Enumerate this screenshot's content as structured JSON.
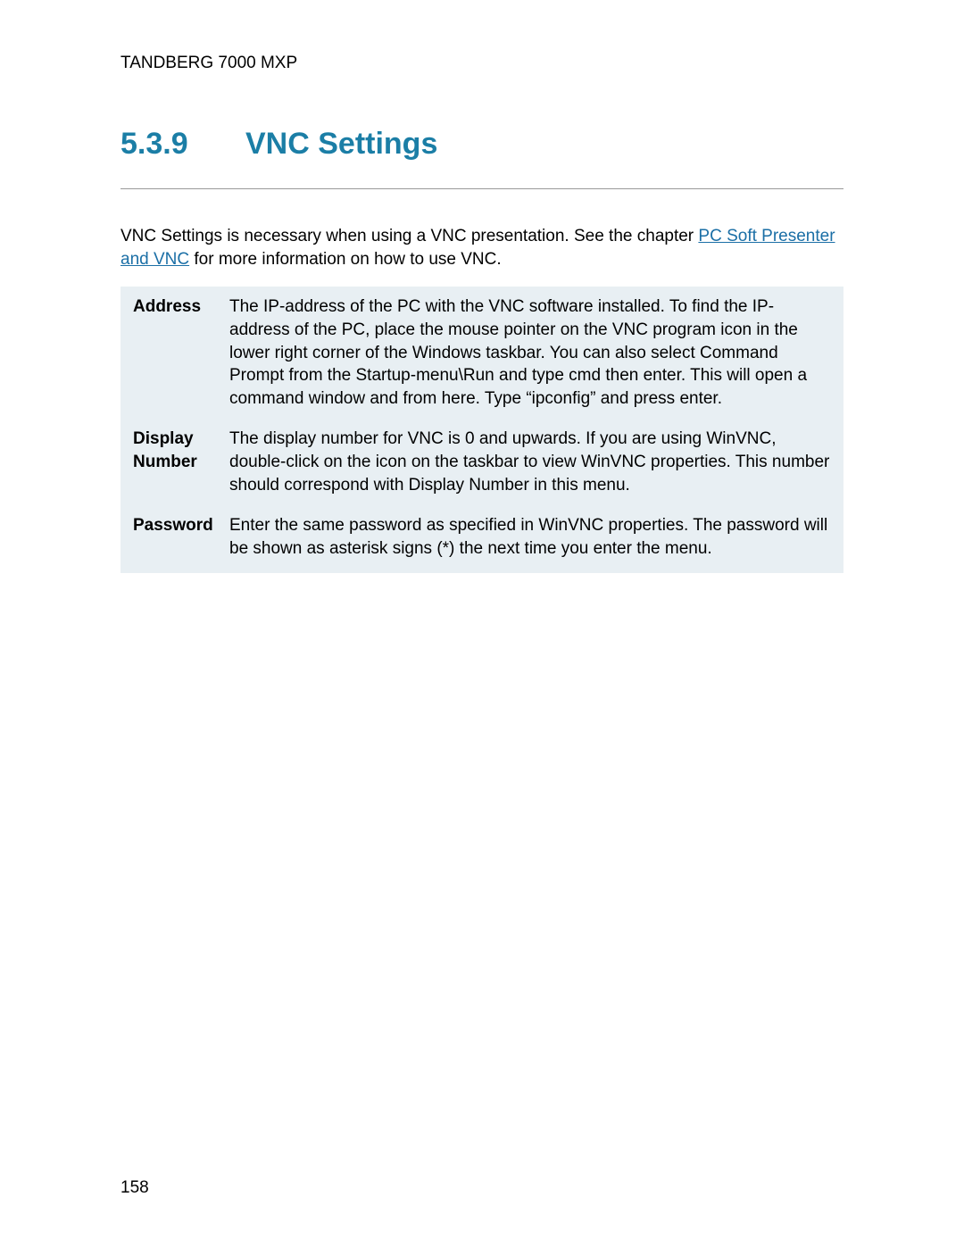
{
  "header": "TANDBERG 7000 MXP",
  "section": {
    "number": "5.3.9",
    "title": "VNC Settings"
  },
  "intro": {
    "before_link": "VNC Settings is necessary when using a VNC presentation. See the chapter ",
    "link": "PC Soft Presenter and VNC",
    "after_link": " for more information on how to use VNC."
  },
  "rows": [
    {
      "label": "Address",
      "desc": "The IP-address of the PC with the VNC software installed. To find the IP-address of the PC, place the mouse pointer on the VNC program icon in the lower right corner of the Windows taskbar. You can also select Command Prompt from the Startup-menu\\Run and type cmd then enter. This will open a command window and from here. Type “ipconfig” and press enter."
    },
    {
      "label": "Display Number",
      "desc": "The display number for VNC is 0 and upwards. If you are using WinVNC, double-click on the icon on the taskbar to view WinVNC properties. This number should correspond with Display Number in this menu."
    },
    {
      "label": "Password",
      "desc": "Enter the same password as specified in WinVNC properties. The password will be shown as asterisk signs (*) the next time you enter the menu."
    }
  ],
  "page_number": "158"
}
